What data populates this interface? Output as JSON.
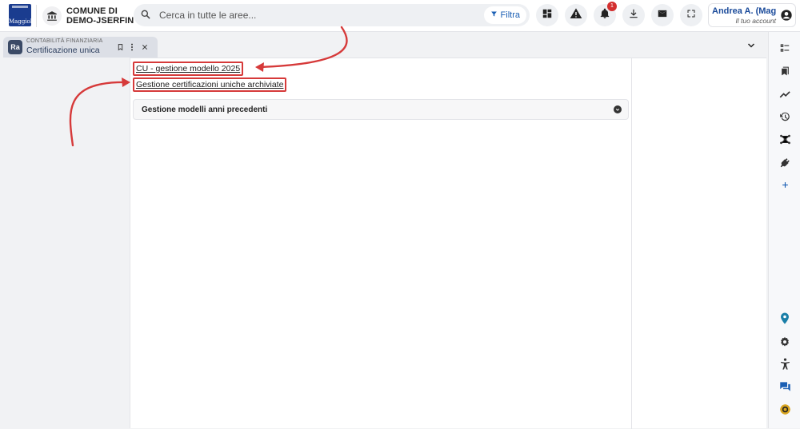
{
  "header": {
    "logo_text": "Maggioli",
    "org_line1": "COMUNE DI",
    "org_line2": "DEMO-JSERFIN",
    "search_placeholder": "Cerca in tutte le aree...",
    "filter_label": "Filtra",
    "notifications_count": "1",
    "account_name": "Andrea A. (Mag...",
    "account_sub": "Il tuo account"
  },
  "tab": {
    "icon_text": "Ra",
    "category": "CONTABILITÀ FINANZIARIA",
    "title": "Certificazione unica"
  },
  "main": {
    "links": [
      {
        "label": "CU - gestione modello 2025"
      },
      {
        "label": "Gestione certificazioni uniche archiviate"
      }
    ],
    "section_title": "Gestione modelli anni precedenti"
  },
  "colors": {
    "annotation_red": "#d63a3a",
    "brand_blue": "#1a3c8f",
    "badge_red": "#d32f2f",
    "pin_teal": "#1a7fa8"
  },
  "icons": {
    "toolbar": [
      "dashboard-icon",
      "warning-icon",
      "bell-icon",
      "download-icon",
      "mail-icon",
      "fullscreen-icon"
    ],
    "sidebar_top": [
      "checklist-icon",
      "bookmarks-icon",
      "trend-icon",
      "history-icon",
      "network-icon",
      "plug-icon",
      "add-icon"
    ],
    "sidebar_bottom": [
      "location-pin-icon",
      "settings-icon",
      "accessibility-icon",
      "chat-icon",
      "help-icon"
    ]
  }
}
